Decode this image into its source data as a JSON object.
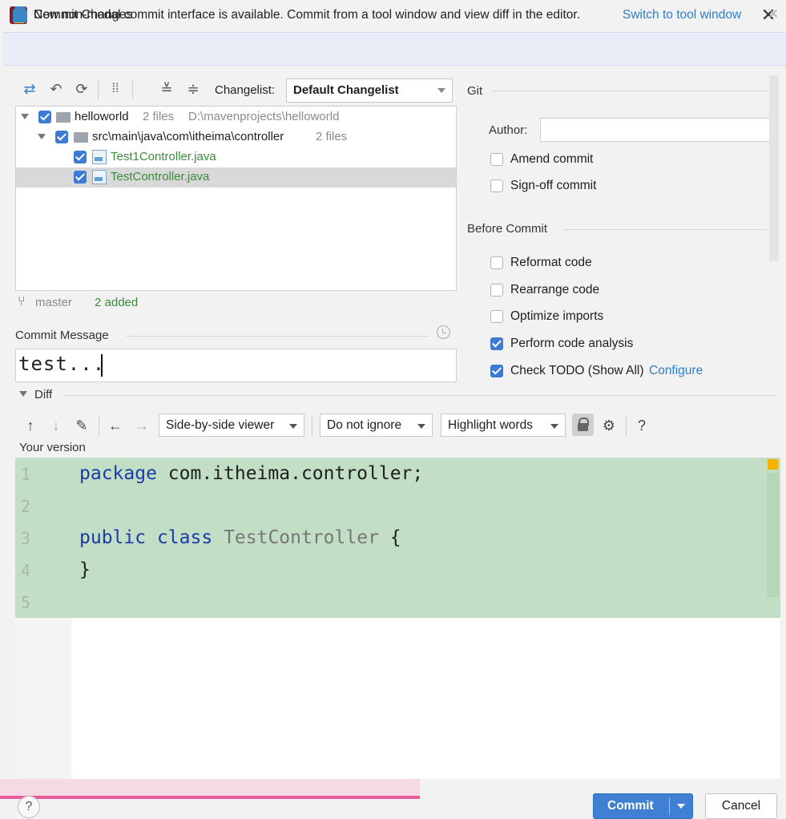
{
  "window": {
    "title": "Commit Changes",
    "close_glyph": "✕"
  },
  "banner": {
    "text": "New non-modal commit interface is available. Commit from a tool window and view diff in the editor.",
    "link": "Switch to tool window",
    "close_glyph": "✕"
  },
  "toolbar": {
    "icons": [
      "move-changes-icon",
      "rollback-icon",
      "refresh-icon",
      "group-by-icon",
      "expand-all-icon",
      "collapse-all-icon"
    ],
    "changelist_label": "Changelist:",
    "changelist_value": "Default Changelist"
  },
  "tree": {
    "rows": [
      {
        "name": "helloworld",
        "meta": "2 files",
        "path": "D:\\mavenprojects\\helloworld"
      },
      {
        "name": "src\\main\\java\\com\\itheima\\controller",
        "meta": "2 files"
      },
      {
        "name": "Test1Controller.java"
      },
      {
        "name": "TestController.java"
      }
    ]
  },
  "status": {
    "branch": "master",
    "added": "2 added"
  },
  "commit_message": {
    "label": "Commit Message",
    "value": "test..."
  },
  "git": {
    "section_label": "Git",
    "author_label": "Author:",
    "author_value": "",
    "options": [
      {
        "label": "Amend commit",
        "checked": false
      },
      {
        "label": "Sign-off commit",
        "checked": false
      }
    ]
  },
  "before_commit": {
    "section_label": "Before Commit",
    "options": [
      {
        "label": "Reformat code",
        "checked": false
      },
      {
        "label": "Rearrange code",
        "checked": false
      },
      {
        "label": "Optimize imports",
        "checked": false
      },
      {
        "label": "Perform code analysis",
        "checked": true
      },
      {
        "label": "Check TODO (Show All)",
        "link": "Configure",
        "checked": true
      }
    ]
  },
  "diff": {
    "label": "Diff",
    "viewer": "Side-by-side viewer",
    "ignore": "Do not ignore",
    "highlight": "Highlight words",
    "help_glyph": "?",
    "version_label": "Your version",
    "lines": [
      {
        "n": "1",
        "parts": [
          [
            "kw",
            "package"
          ],
          [
            "",
            " com.itheima.controller;"
          ]
        ]
      },
      {
        "n": "2",
        "parts": []
      },
      {
        "n": "3",
        "parts": [
          [
            "kw",
            "public"
          ],
          [
            "",
            " "
          ],
          [
            "kw",
            "class"
          ],
          [
            "",
            " "
          ],
          [
            "cls",
            "TestController"
          ],
          [
            "",
            " {"
          ]
        ]
      },
      {
        "n": "4",
        "parts": [
          [
            "",
            "}"
          ]
        ]
      },
      {
        "n": "5",
        "parts": []
      }
    ],
    "added_color": "#c2dfc5"
  },
  "buttons": {
    "help": "?",
    "commit": "Commit",
    "cancel": "Cancel"
  },
  "colors": {
    "accent": "#3f80d2",
    "link": "#2f7fc7",
    "added_text": "#3a8c3a"
  }
}
